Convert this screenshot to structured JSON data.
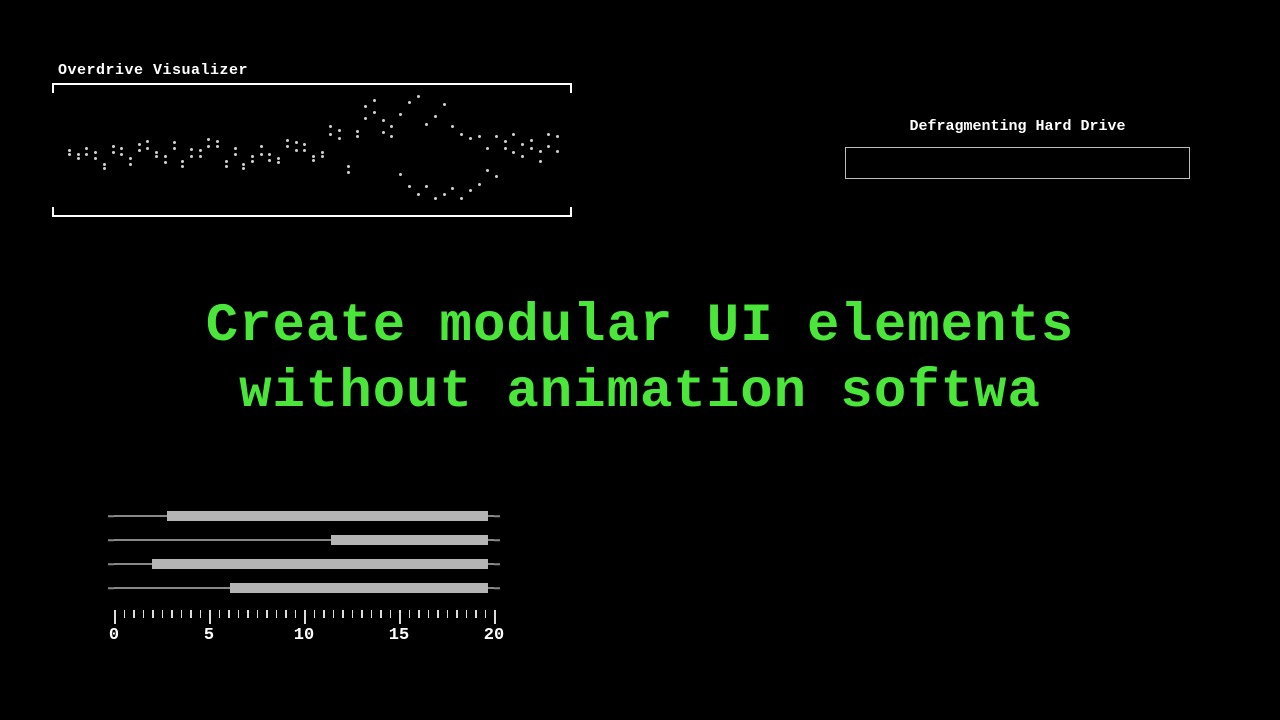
{
  "visualizer": {
    "title": "Overdrive Visualizer",
    "series_top": [
      64,
      68,
      62,
      66,
      78,
      60,
      62,
      72,
      58,
      55,
      66,
      70,
      56,
      75,
      63,
      64,
      53,
      55,
      75,
      62,
      78,
      70,
      60,
      68,
      72,
      54,
      56,
      58,
      70,
      66,
      40,
      44,
      80,
      45,
      20,
      14,
      34,
      40,
      28,
      16,
      10,
      38,
      30,
      18,
      40,
      48,
      52,
      50,
      62,
      50,
      55,
      48,
      58,
      54,
      65,
      48,
      50
    ],
    "series_bottom": [
      68,
      72,
      68,
      72,
      82,
      66,
      68,
      78,
      64,
      62,
      70,
      76,
      62,
      80,
      70,
      70,
      60,
      60,
      80,
      68,
      82,
      75,
      68,
      74,
      76,
      60,
      64,
      64,
      74,
      70,
      48,
      52,
      86,
      50,
      32,
      26,
      46,
      50,
      88,
      100,
      108,
      100,
      112,
      108,
      102,
      112,
      104,
      98,
      84,
      90,
      62,
      66,
      70,
      62,
      75,
      60,
      65
    ]
  },
  "defrag": {
    "title": "Defragmenting Hard Drive",
    "progress": 0
  },
  "headline": {
    "line1": "Create modular UI elements",
    "line2": "without animation softwa"
  },
  "ranges": {
    "scale_max": 20,
    "bars": [
      {
        "start": 2.8,
        "end": 19.7
      },
      {
        "start": 11.4,
        "end": 19.7
      },
      {
        "start": 2.0,
        "end": 19.7
      },
      {
        "start": 6.1,
        "end": 19.7
      }
    ],
    "ticks": [
      0,
      5,
      10,
      15,
      20
    ]
  }
}
